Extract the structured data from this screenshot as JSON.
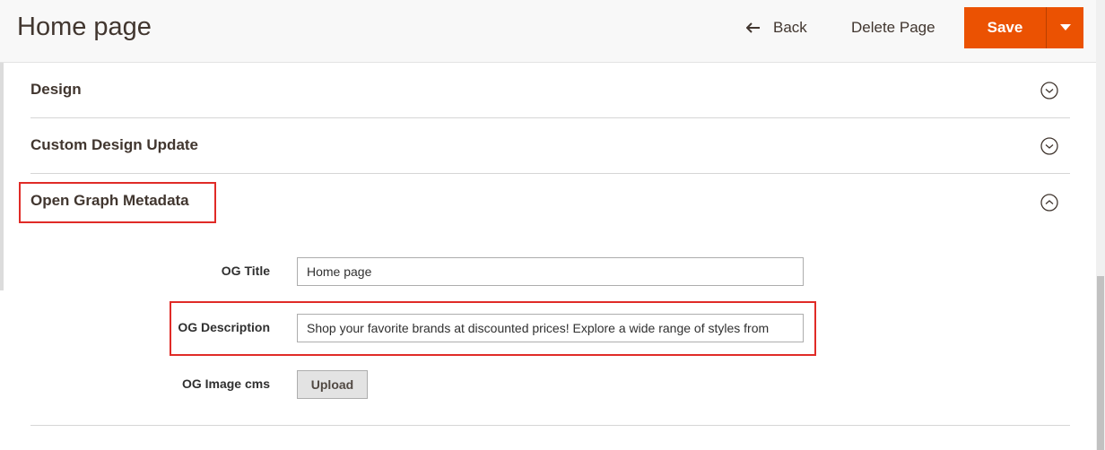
{
  "header": {
    "title": "Home page",
    "back_label": "Back",
    "delete_label": "Delete Page",
    "save_label": "Save",
    "back_icon": "arrow-left-icon",
    "toggle_icon": "caret-down-icon"
  },
  "sections": {
    "design": {
      "title": "Design",
      "state": "collapsed"
    },
    "custom_design": {
      "title": "Custom Design Update",
      "state": "collapsed"
    },
    "open_graph": {
      "title": "Open Graph Metadata",
      "state": "expanded"
    }
  },
  "og_form": {
    "og_title_label": "OG Title",
    "og_title_value": "Home page",
    "og_description_label": "OG Description",
    "og_description_value": "Shop your favorite brands at discounted prices! Explore a wide range of styles from",
    "og_image_label": "OG Image cms",
    "upload_label": "Upload"
  },
  "colors": {
    "accent": "#eb5202",
    "highlight": "#e02b27"
  }
}
